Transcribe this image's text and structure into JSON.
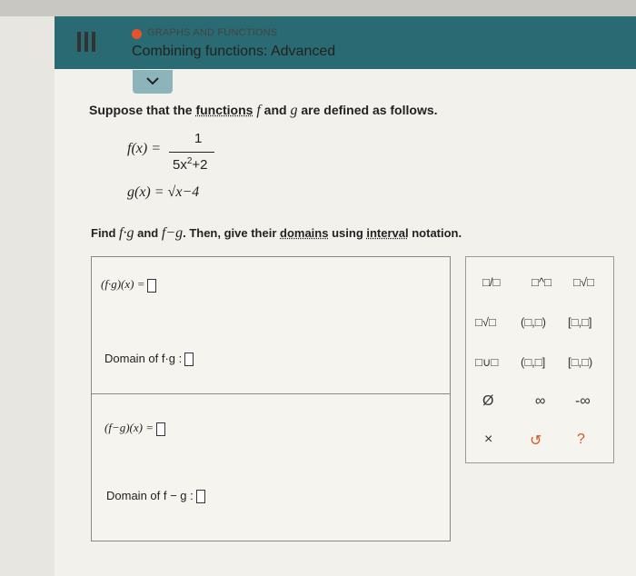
{
  "header": {
    "category": "GRAPHS AND FUNCTIONS",
    "topic": "Combining functions: Advanced",
    "accent_color": "#e5532e",
    "header_color": "#2a6a72"
  },
  "problem": {
    "intro_pre": "Suppose that the ",
    "intro_link": "functions",
    "intro_f": "f",
    "intro_and": " and ",
    "intro_g": "g",
    "intro_post": " are defined as follows.",
    "f_lhs": "f(x) =",
    "f_num": "1",
    "f_den_base": "5x",
    "f_den_exp": "2",
    "f_den_tail": "+2",
    "g_def": "g(x) = √x−4",
    "find_pre": "Find ",
    "find_fg": "f·g",
    "find_and": " and ",
    "find_fmg": "f−g",
    "find_mid": ". Then, give their ",
    "find_link1": "domains",
    "find_using": " using ",
    "find_link2": "interval",
    "find_post": " notation."
  },
  "answers": {
    "product_expr": "(f·g)(x) =",
    "product_domain": "Domain of f·g :",
    "difference_expr": "(f−g)(x) =",
    "difference_domain": "Domain of f − g :"
  },
  "palette": {
    "fraction": "□/□",
    "exponent": "□^□",
    "sqrt": "□√□",
    "nth_root": "□√□",
    "open_open": "(□,□)",
    "closed_closed": "[□,□]",
    "union": "□∪□",
    "open_closed": "(□,□]",
    "closed_open": "[□,□)",
    "empty_set": "Ø",
    "infinity": "∞",
    "neg_infinity": "-∞",
    "clear": "×",
    "undo": "↺",
    "help": "?"
  }
}
